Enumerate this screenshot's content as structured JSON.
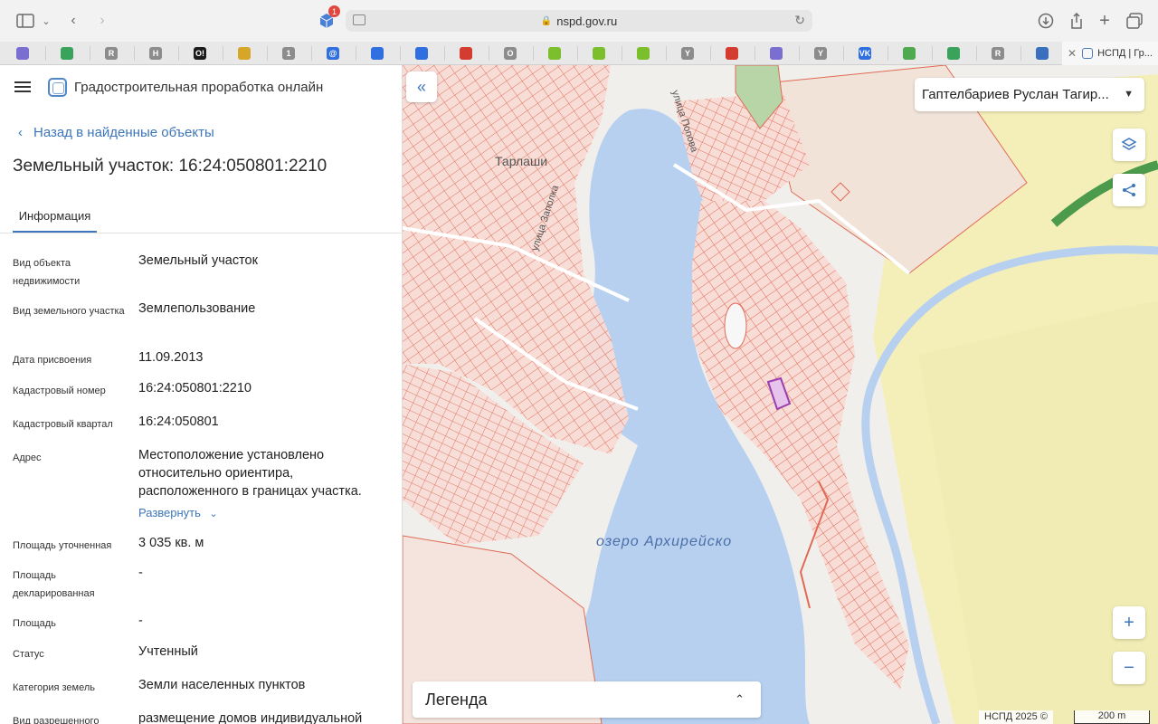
{
  "browser": {
    "url": "nspd.gov.ru",
    "extension_badge": "1",
    "active_tab_title": "НСПД | Гр...",
    "favicons": [
      {
        "name": "bookmark-icon",
        "glyph": "",
        "color": "#7a6fd0"
      },
      {
        "name": "home-icon",
        "glyph": "",
        "color": "#3aa35b"
      },
      {
        "name": "r-icon",
        "glyph": "R",
        "color": "#8c8c8c"
      },
      {
        "name": "h-icon",
        "glyph": "H",
        "color": "#8c8c8c"
      },
      {
        "name": "ok-icon",
        "glyph": "O!",
        "color": "#1b1b1b"
      },
      {
        "name": "coin-icon",
        "glyph": "",
        "color": "#d6a629"
      },
      {
        "name": "one-icon",
        "glyph": "1",
        "color": "#8c8c8c"
      },
      {
        "name": "at-icon",
        "glyph": "@",
        "color": "#2f6fe0"
      },
      {
        "name": "mail-icon",
        "glyph": "",
        "color": "#2f6fe0"
      },
      {
        "name": "mail-icon-2",
        "glyph": "",
        "color": "#2f6fe0"
      },
      {
        "name": "flag-icon",
        "glyph": "",
        "color": "#d43c2f"
      },
      {
        "name": "o-icon",
        "glyph": "O",
        "color": "#8c8c8c"
      },
      {
        "name": "key-icon",
        "glyph": "",
        "color": "#7cbf2d"
      },
      {
        "name": "key-icon-2",
        "glyph": "",
        "color": "#7cbf2d"
      },
      {
        "name": "key-icon-3",
        "glyph": "",
        "color": "#7cbf2d"
      },
      {
        "name": "y-icon",
        "glyph": "Y",
        "color": "#8c8c8c"
      },
      {
        "name": "flag-icon-2",
        "glyph": "",
        "color": "#d43c2f"
      },
      {
        "name": "bookmark-icon-2",
        "glyph": "",
        "color": "#7a6fd0"
      },
      {
        "name": "y-icon-2",
        "glyph": "Y",
        "color": "#8c8c8c"
      },
      {
        "name": "vk-icon",
        "glyph": "VK",
        "color": "#2f6fe0"
      },
      {
        "name": "frog-icon",
        "glyph": "",
        "color": "#4fa94f"
      },
      {
        "name": "home-icon-2",
        "glyph": "",
        "color": "#3aa35b"
      },
      {
        "name": "r-icon-2",
        "glyph": "R",
        "color": "#8c8c8c"
      },
      {
        "name": "planet-icon",
        "glyph": "",
        "color": "#3a6fc0"
      }
    ]
  },
  "panel": {
    "app_title": "Градостроительная проработка онлайн",
    "back_label": "Назад в найденные объекты",
    "object_title": "Земельный участок: 16:24:050801:2210",
    "tab_label": "Информация",
    "expand_label": "Развернуть",
    "rows": [
      {
        "label": "Вид объекта недвижимости",
        "value": "Земельный участок"
      },
      {
        "label": "Вид земельного участка",
        "value": "Землепользование"
      },
      {
        "label": "Дата присвоения",
        "value": "11.09.2013"
      },
      {
        "label": "Кадастровый номер",
        "value": "16:24:050801:2210"
      },
      {
        "label": "Кадастровый квартал",
        "value": "16:24:050801"
      },
      {
        "label": "Адрес",
        "value": "Местоположение установлено относительно ориентира, расположенного в границах участка."
      },
      {
        "label": "Площадь уточненная",
        "value": "3 035 кв. м"
      },
      {
        "label": "Площадь декларированная",
        "value": "-"
      },
      {
        "label": "Площадь",
        "value": "-"
      },
      {
        "label": "Статус",
        "value": "Учтенный"
      },
      {
        "label": "Категория земель",
        "value": "Земли населенных пунктов"
      },
      {
        "label": "Вид разрешенного",
        "value": "размещение домов индивидуальной"
      }
    ]
  },
  "map": {
    "user_name": "Гаптелбариев Руслан Тагир...",
    "legend_label": "Легенда",
    "copyright": "НСПД 2025 ©",
    "scale_label": "200 m",
    "lake_label": "озеро Архирейско",
    "place_label": "Тарлаши",
    "street_1": "улица Попова",
    "street_2": "улица Заполка",
    "colors": {
      "parcel": "#e06a55",
      "parcel_fill": "#f8dcd6",
      "water": "#b7d0f0",
      "agri": "#f4efb8",
      "selected": "#9b3fb0"
    }
  }
}
